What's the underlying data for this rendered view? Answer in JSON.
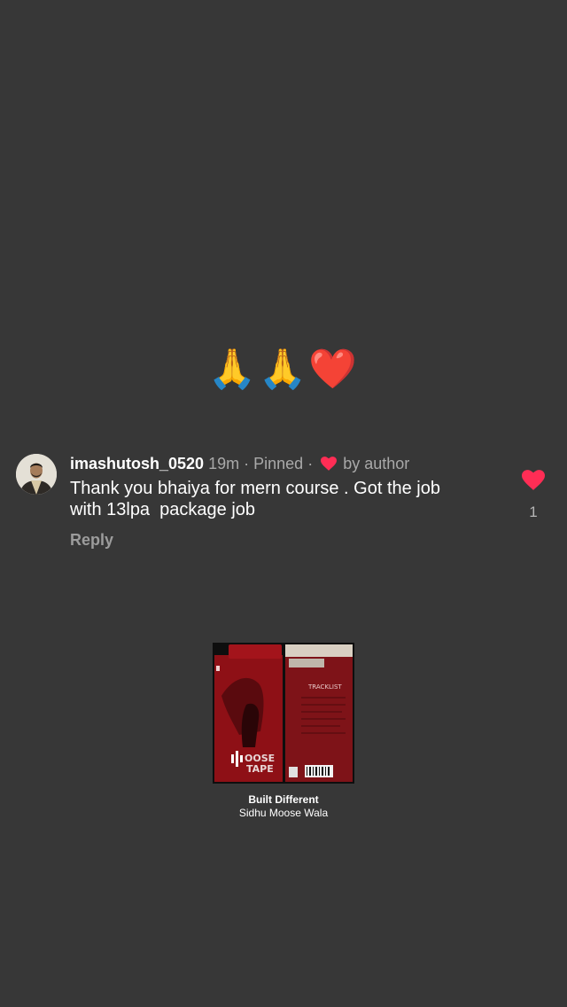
{
  "reaction": {
    "emojis": "🙏🙏❤️"
  },
  "comment": {
    "username": "imashutosh_0520",
    "time": "19m",
    "separator": "·",
    "pinned": "Pinned",
    "liked_by": "by author",
    "text": "Thank you bhaiya for mern course . Got the job\nwith 13lpa  package job",
    "reply_label": "Reply",
    "like_count": "1",
    "like_color": "#ff2d55"
  },
  "music": {
    "title": "Built Different",
    "artist": "Sidhu Moose Wala",
    "cover_text": "MOOSE TAPE"
  }
}
